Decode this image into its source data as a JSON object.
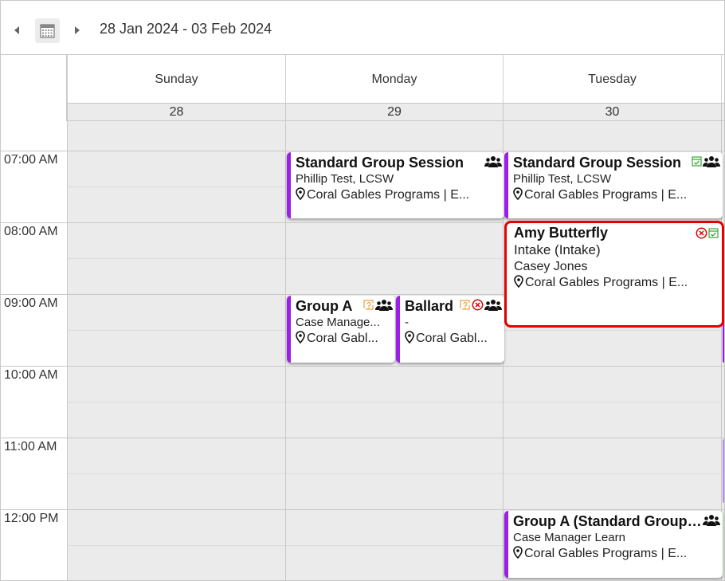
{
  "toolbar": {
    "date_range": "28 Jan 2024 - 03 Feb 2024"
  },
  "days": [
    {
      "name": "Sunday",
      "date": "28"
    },
    {
      "name": "Monday",
      "date": "29"
    },
    {
      "name": "Tuesday",
      "date": "30"
    }
  ],
  "times": [
    "07:00 AM",
    "08:00 AM",
    "09:00 AM",
    "10:00 AM",
    "11:00 AM",
    "12:00 PM"
  ],
  "colors": {
    "event_accent": "#9b1fe8",
    "selected_border": "#e60000",
    "grid_bg": "#ebebeb",
    "reschedule_icon": "#e8a33a",
    "cancel_icon": "#e00000",
    "checkin_icon": "#3aa63a"
  },
  "events": {
    "mon_7am": {
      "title": "Standard Group Session",
      "line1": "Phillip Test, LCSW",
      "location": "Coral Gables Programs | E...",
      "icons": [
        "group-icon"
      ]
    },
    "tue_7am": {
      "title": "Standard Group Session",
      "line1": "Phillip Test, LCSW",
      "location": "Coral Gables Programs | E...",
      "icons": [
        "check-calendar-icon",
        "group-icon"
      ]
    },
    "tue_8am": {
      "title": "Amy Butterfly",
      "line1": "Intake (Intake)",
      "line2": "Casey Jones",
      "location": "Coral Gables Programs | E...",
      "icons": [
        "cancel-icon",
        "check-calendar-icon"
      ]
    },
    "mon_9am_a": {
      "title": "Group A",
      "line1": "Case Manage...",
      "location": "Coral Gabl...",
      "icons": [
        "reschedule-icon",
        "group-icon"
      ]
    },
    "mon_9am_b": {
      "title": "Ballard",
      "line1": "-",
      "location": "Coral Gabl...",
      "icons": [
        "reschedule-icon",
        "cancel-icon",
        "group-icon"
      ]
    },
    "tue_12pm": {
      "title": "Group A (Standard Group Session)",
      "line1": "Case Manager Learn",
      "location": "Coral Gables Programs | E...",
      "icons": [
        "group-icon"
      ]
    }
  }
}
